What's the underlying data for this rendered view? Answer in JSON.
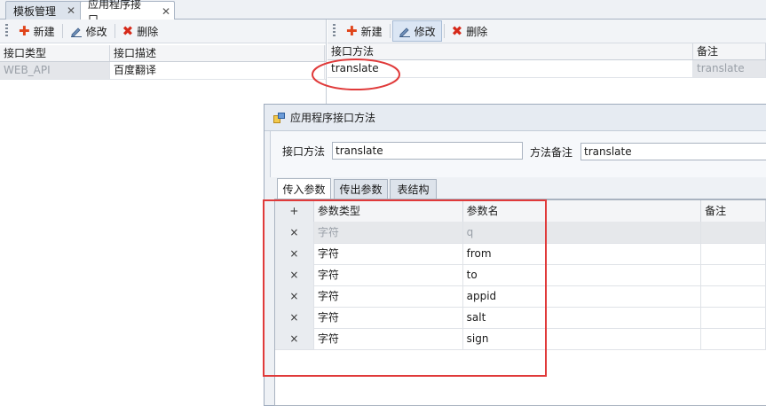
{
  "tabs": [
    {
      "label": "模板管理",
      "close": "✕"
    },
    {
      "label": "应用程序接口",
      "close": "✕"
    }
  ],
  "toolbar": {
    "new_label": "新建",
    "edit_label": "修改",
    "delete_label": "删除"
  },
  "left_grid": {
    "columns": [
      "接口类型",
      "接口描述"
    ],
    "rows": [
      {
        "type": "WEB_API",
        "desc": "百度翻译"
      }
    ]
  },
  "right_grid": {
    "columns": [
      "接口方法",
      "备注"
    ],
    "rows": [
      {
        "method": "translate",
        "note": "translate"
      }
    ]
  },
  "dialog": {
    "title": "应用程序接口方法",
    "method_label": "接口方法",
    "method_value": "translate",
    "note_label": "方法备注",
    "note_value": "translate",
    "tabs": [
      "传入参数",
      "传出参数",
      "表结构"
    ],
    "grid": {
      "add_symbol": "+",
      "columns": [
        "参数类型",
        "参数名",
        "备注"
      ],
      "delete_symbol": "×",
      "rows": [
        {
          "type": "字符",
          "name": "q"
        },
        {
          "type": "字符",
          "name": "from"
        },
        {
          "type": "字符",
          "name": "to"
        },
        {
          "type": "字符",
          "name": "appid"
        },
        {
          "type": "字符",
          "name": "salt"
        },
        {
          "type": "字符",
          "name": "sign"
        }
      ]
    }
  },
  "colors": {
    "annotation": "#e03a3a",
    "accent": "#e0441a"
  }
}
